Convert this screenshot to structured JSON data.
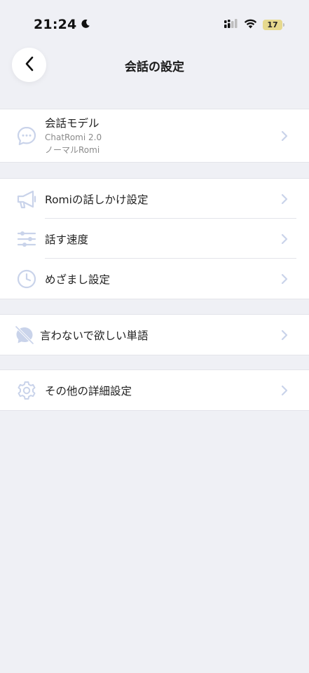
{
  "status_bar": {
    "time": "21:24",
    "battery": "17"
  },
  "header": {
    "title": "会話の設定"
  },
  "sections": {
    "model": {
      "label": "会話モデル",
      "line1": "ChatRomi 2.0",
      "line2": "ノーマルRomi"
    },
    "talk": {
      "romi_talk": "Romiの話しかけ設定",
      "speed": "話す速度",
      "alarm": "めざまし設定"
    },
    "words": {
      "ng_words": "言わないで欲しい単語"
    },
    "other": {
      "details": "その他の詳細設定"
    }
  },
  "colors": {
    "background": "#eff0f5",
    "icon": "#c9d3ea",
    "chevron": "#c9d3ea",
    "battery": "#e6d98e"
  }
}
